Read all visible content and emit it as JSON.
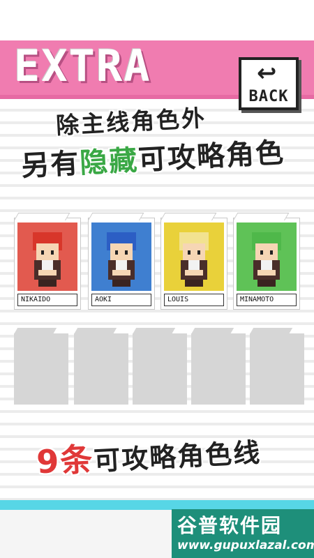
{
  "header": {
    "title": "EXTRA",
    "back_label": "BACK",
    "back_icon": "return-arrow-icon"
  },
  "promo": {
    "line1": "除主线角色外",
    "line2_a": "另有",
    "line2_green": "隐藏",
    "line2_b": "可攻略角色",
    "line3_red": "9条",
    "line3_b": "可攻略角色线"
  },
  "characters": [
    {
      "name": "NIKAIDO",
      "bg": "#e25a4f",
      "hair": "#d8362a"
    },
    {
      "name": "AOKI",
      "bg": "#3f7fd0",
      "hair": "#2c5ec4"
    },
    {
      "name": "LOUIS",
      "bg": "#e9d13a",
      "hair": "#f2e290"
    },
    {
      "name": "MINAMOTO",
      "bg": "#5fc257",
      "hair": "#4fb84a"
    }
  ],
  "locked_slots": 5,
  "watermark": {
    "cn": "谷普软件园",
    "url": "www.gupuxlazal.com"
  },
  "colors": {
    "pink": "#f07cb0",
    "cyan": "#57d6e6",
    "accent_green": "#3aa845",
    "accent_red": "#e03838"
  }
}
